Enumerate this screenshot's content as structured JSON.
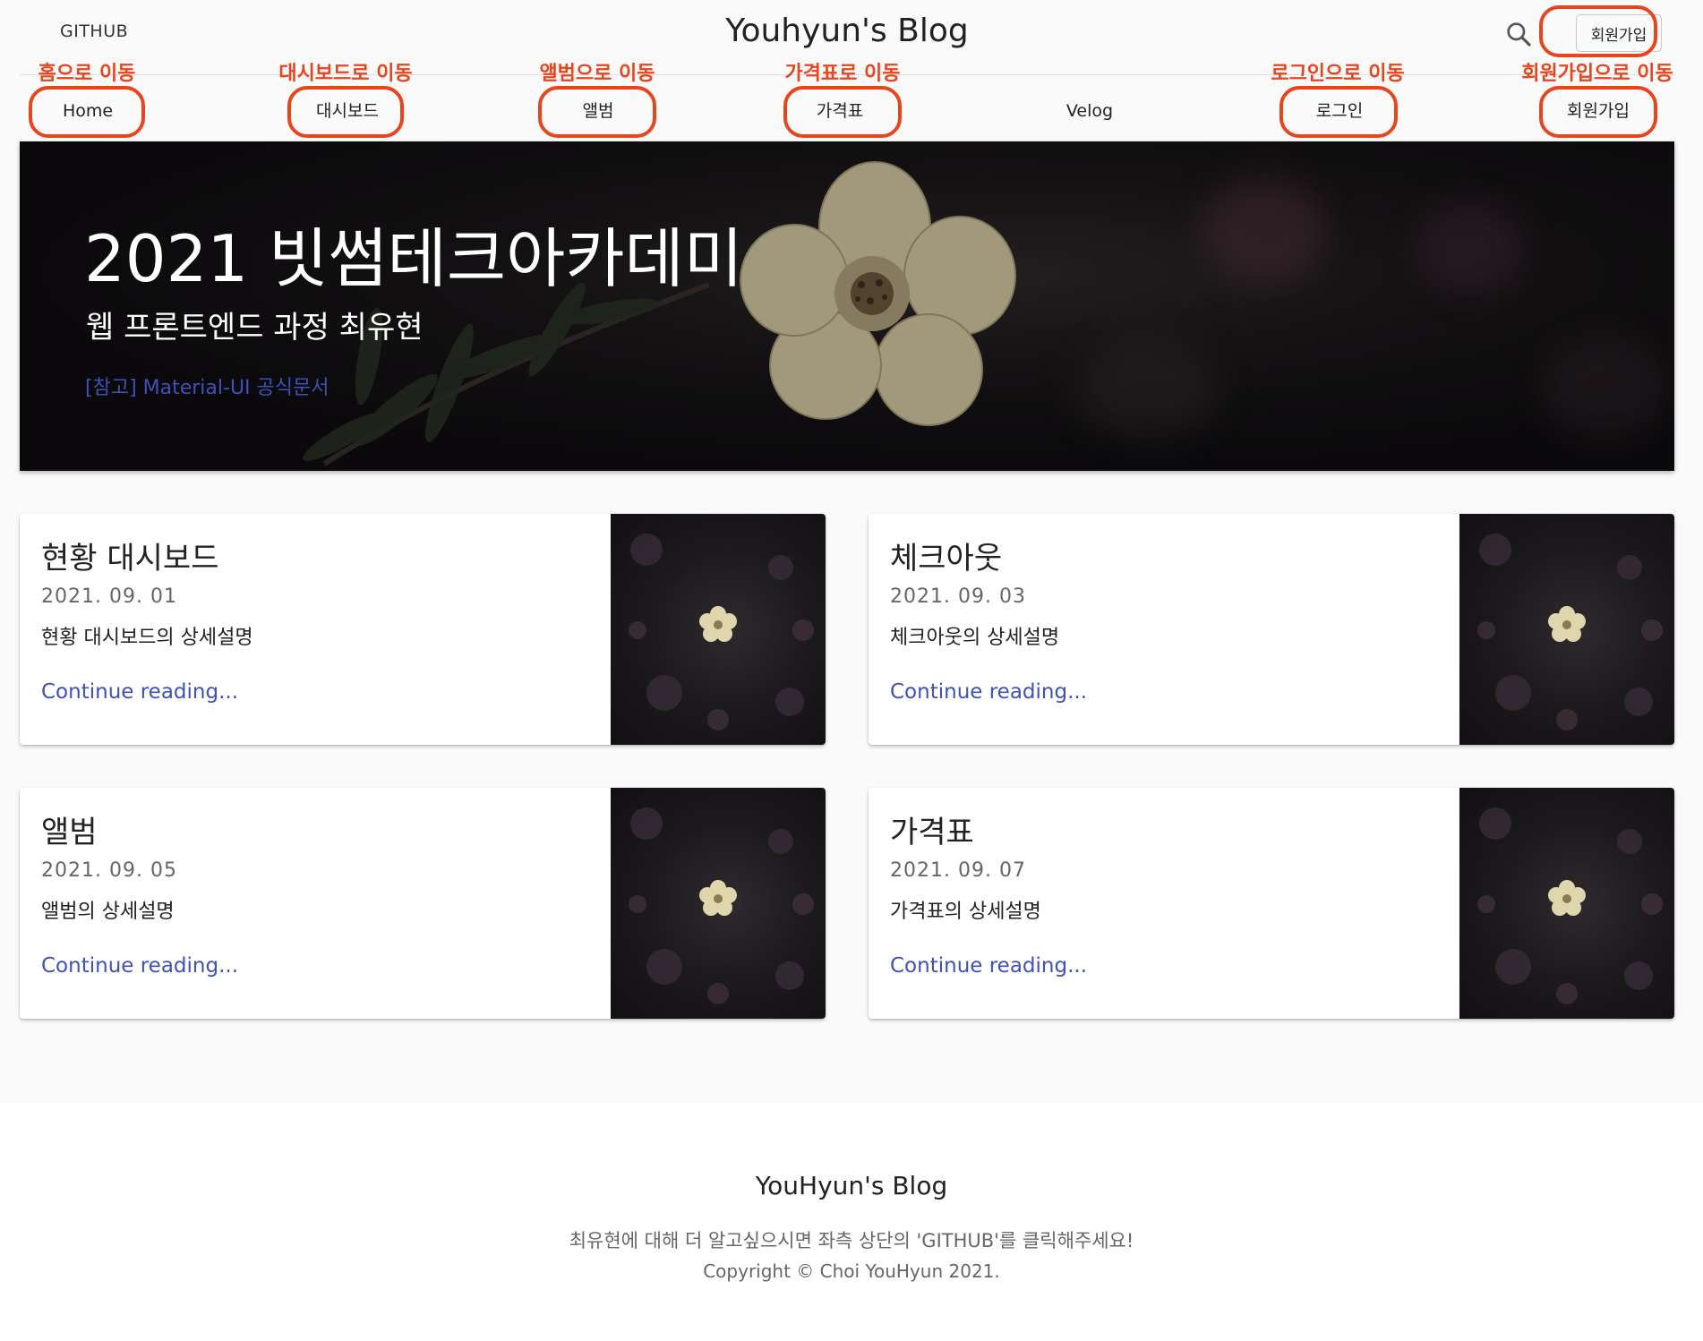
{
  "header": {
    "github_label": "GITHUB",
    "title": "Youhyun's Blog",
    "search_icon": "search-icon",
    "signup_label": "회원가입"
  },
  "nav": {
    "home": "Home",
    "dashboard": "대시보드",
    "album": "앨범",
    "pricing": "가격표",
    "velog": "Velog",
    "login": "로그인",
    "signup": "회원가입"
  },
  "annotations": {
    "home": "홈으로 이동",
    "dashboard": "대시보드로 이동",
    "album": "앨범으로 이동",
    "pricing": "가격표로 이동",
    "login": "로그인으로 이동",
    "signup": "회원가입으로 이동",
    "color": "#e8451e"
  },
  "hero": {
    "title": "2021 빗썸테크아카데미",
    "subtitle": "웹 프론트엔드 과정 최유현",
    "link": "[참고] Material-UI 공식문서"
  },
  "cards": [
    {
      "title": "현황 대시보드",
      "date": "2021. 09. 01",
      "description": "현황 대시보드의 상세설명",
      "link": "Continue reading..."
    },
    {
      "title": "체크아웃",
      "date": "2021. 09. 03",
      "description": "체크아웃의 상세설명",
      "link": "Continue reading..."
    },
    {
      "title": "앨범",
      "date": "2021. 09. 05",
      "description": "앨범의 상세설명",
      "link": "Continue reading..."
    },
    {
      "title": "가격표",
      "date": "2021. 09. 07",
      "description": "가격표의 상세설명",
      "link": "Continue reading..."
    }
  ],
  "footer": {
    "title": "YouHyun's Blog",
    "description": "최유현에 대해 더 알고싶으시면 좌측 상단의 'GITHUB'를 클릭해주세요!",
    "copyright": "Copyright © Choi YouHyun 2021."
  },
  "colors": {
    "link": "#3f51b5",
    "annotation": "#e8451e",
    "background": "#fafafa"
  }
}
